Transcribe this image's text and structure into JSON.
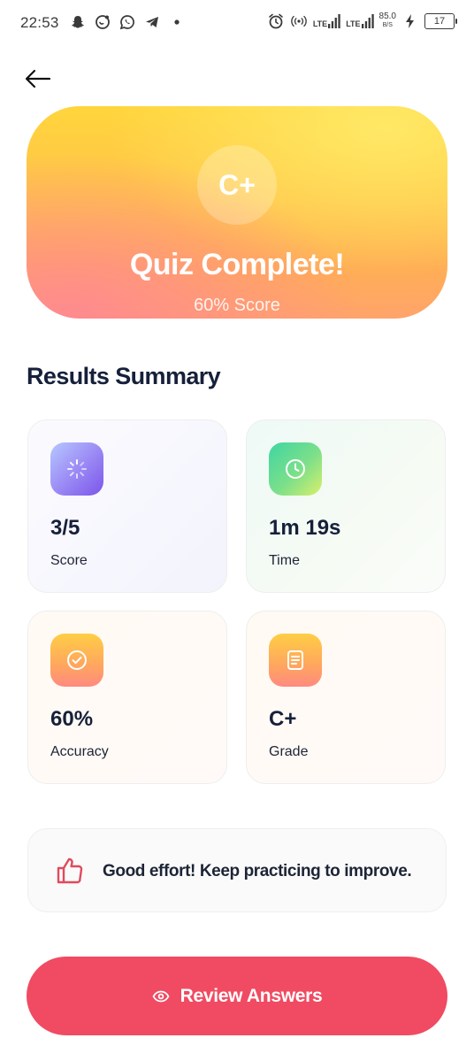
{
  "status_bar": {
    "time": "22:53",
    "lte1": "LTE",
    "lte2": "LTE",
    "speed_value": "85.0",
    "speed_unit": "B/S",
    "battery": "17",
    "left_icons": [
      "snapchat-icon",
      "bubble-icon",
      "whatsapp-icon",
      "telegram-icon",
      "dot-icon"
    ],
    "right_icons": [
      "alarm-icon",
      "hotspot-icon",
      "signal-icon",
      "signal-icon",
      "charging-icon",
      "battery-icon"
    ]
  },
  "hero": {
    "grade": "C+",
    "title": "Quiz Complete!",
    "subtitle": "60% Score"
  },
  "summary": {
    "title": "Results Summary",
    "cards": [
      {
        "value": "3/5",
        "label": "Score",
        "icon": "loader-icon"
      },
      {
        "value": "1m 19s",
        "label": "Time",
        "icon": "clock-icon"
      },
      {
        "value": "60%",
        "label": "Accuracy",
        "icon": "check-circle-icon"
      },
      {
        "value": "C+",
        "label": "Grade",
        "icon": "document-icon"
      }
    ]
  },
  "feedback": {
    "message": "Good effort! Keep practicing to improve.",
    "icon": "thumbs-up-icon",
    "icon_color": "#e04a5e"
  },
  "actions": {
    "review_label": "Review Answers",
    "review_color": "#f04b62"
  }
}
